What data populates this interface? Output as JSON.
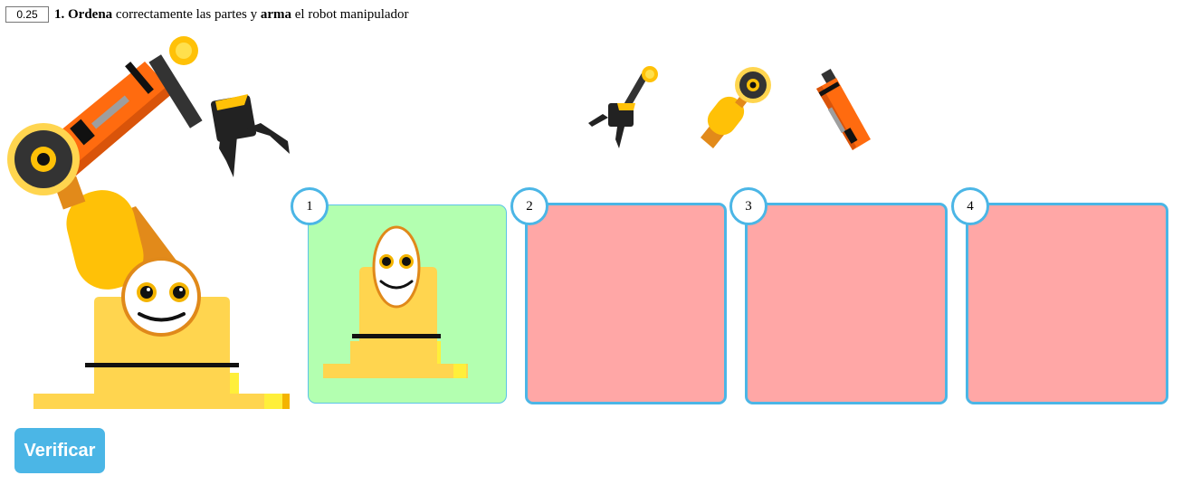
{
  "question": {
    "score": "0.25",
    "number": "1.",
    "word_bold_1": "Ordena",
    "text_1": " correctamente las partes y ",
    "word_bold_2": "arma",
    "text_2": " el robot manipulador"
  },
  "slots": [
    {
      "number": "1",
      "state": "filled",
      "color": "#b3ffb0"
    },
    {
      "number": "2",
      "state": "empty",
      "color": "#ffa7a6"
    },
    {
      "number": "3",
      "state": "empty",
      "color": "#ffa7a6"
    },
    {
      "number": "4",
      "state": "empty",
      "color": "#ffa7a6"
    }
  ],
  "pieces": [
    {
      "name": "gripper-piece-icon"
    },
    {
      "name": "elbow-joint-piece-icon"
    },
    {
      "name": "forearm-piece-icon"
    }
  ],
  "actions": {
    "verify_label": "Verificar"
  },
  "colors": {
    "accent": "#4bb6e6",
    "robot_orange": "#ff6b0f",
    "robot_yellow": "#ffd54f",
    "joint_yellow": "#ffc107"
  }
}
